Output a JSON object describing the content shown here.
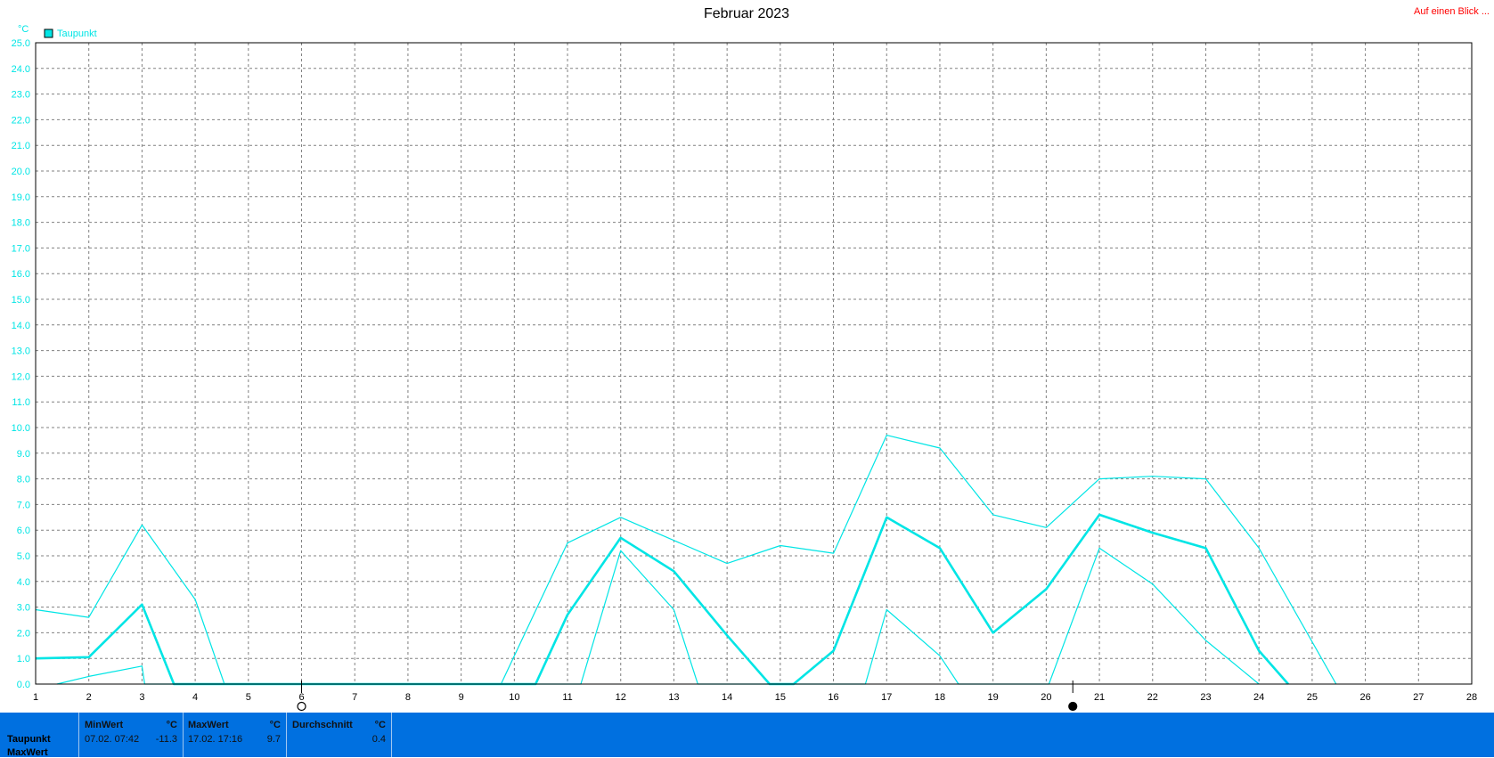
{
  "header": {
    "title": "Februar 2023",
    "quick_link": "Auf einen Blick ..."
  },
  "colors": {
    "series": "#00e5e5",
    "grid": "#808080",
    "stats_bg": "#0070e0",
    "link": "#ff0000"
  },
  "chart_data": {
    "type": "line",
    "unit": "°C",
    "legend": {
      "label": "Taupunkt",
      "placement": "top-left"
    },
    "ylim": [
      0,
      25
    ],
    "yticks": [
      "0.0",
      "1.0",
      "2.0",
      "3.0",
      "4.0",
      "5.0",
      "6.0",
      "7.0",
      "8.0",
      "9.0",
      "10.0",
      "11.0",
      "12.0",
      "13.0",
      "14.0",
      "15.0",
      "16.0",
      "17.0",
      "18.0",
      "19.0",
      "20.0",
      "21.0",
      "22.0",
      "23.0",
      "24.0",
      "25.0"
    ],
    "xlim": [
      1,
      28
    ],
    "xticks": [
      "1",
      "2",
      "3",
      "4",
      "5",
      "6",
      "7",
      "8",
      "9",
      "10",
      "11",
      "12",
      "13",
      "14",
      "15",
      "16",
      "17",
      "18",
      "19",
      "20",
      "21",
      "22",
      "23",
      "24",
      "25",
      "26",
      "27",
      "28"
    ],
    "grid": true,
    "moon_markers": [
      {
        "day": 6.0,
        "phase": "full-moon"
      },
      {
        "day": 20.5,
        "phase": "new-moon"
      }
    ],
    "series": [
      {
        "name": "Taupunkt",
        "role": "max",
        "points": [
          [
            1,
            2.9
          ],
          [
            2,
            2.6
          ],
          [
            3,
            6.2
          ],
          [
            4,
            3.3
          ],
          [
            4.55,
            0
          ],
          [
            9.75,
            0
          ],
          [
            11,
            5.5
          ],
          [
            12,
            6.5
          ],
          [
            13,
            5.6
          ],
          [
            14,
            4.7
          ],
          [
            15,
            5.4
          ],
          [
            16,
            5.1
          ],
          [
            17,
            9.7
          ],
          [
            18,
            9.2
          ],
          [
            19,
            6.6
          ],
          [
            20,
            6.1
          ],
          [
            21,
            8.0
          ],
          [
            22,
            8.1
          ],
          [
            23,
            8.0
          ],
          [
            24,
            5.3
          ],
          [
            25.45,
            0
          ]
        ]
      },
      {
        "name": "Taupunkt",
        "role": "mean",
        "points": [
          [
            1,
            1.0
          ],
          [
            2,
            1.05
          ],
          [
            3,
            3.1
          ],
          [
            3.6,
            0
          ],
          [
            10.4,
            0
          ],
          [
            11,
            2.7
          ],
          [
            12,
            5.7
          ],
          [
            13,
            4.4
          ],
          [
            14,
            1.9
          ],
          [
            14.8,
            0
          ],
          [
            15.25,
            0
          ],
          [
            16,
            1.3
          ],
          [
            17,
            6.5
          ],
          [
            18,
            5.3
          ],
          [
            19,
            2.0
          ],
          [
            20,
            3.7
          ],
          [
            21,
            6.6
          ],
          [
            22,
            5.9
          ],
          [
            23,
            5.3
          ],
          [
            24,
            1.3
          ],
          [
            24.55,
            0
          ]
        ]
      },
      {
        "name": "Taupunkt",
        "role": "min",
        "points": [
          [
            1.4,
            0
          ],
          [
            2,
            0.3
          ],
          [
            3,
            0.7
          ],
          [
            3.05,
            0
          ],
          [
            11.25,
            0
          ],
          [
            12,
            5.2
          ],
          [
            13,
            2.9
          ],
          [
            13.45,
            0
          ],
          [
            16.6,
            0
          ],
          [
            17,
            2.9
          ],
          [
            18,
            1.1
          ],
          [
            18.35,
            0
          ],
          [
            20.05,
            0
          ],
          [
            21,
            5.3
          ],
          [
            22,
            3.9
          ],
          [
            23,
            1.7
          ],
          [
            24,
            0
          ]
        ]
      }
    ]
  },
  "stats": {
    "row_labels": [
      "Taupunkt",
      "MaxWert"
    ],
    "columns": [
      {
        "header": "MinWert",
        "unit": "°C",
        "date": "07.02.  07:42",
        "value": "-11.3"
      },
      {
        "header": "MaxWert",
        "unit": "°C",
        "date": "17.02.  17:16",
        "value": "9.7"
      },
      {
        "header": "Durchschnitt",
        "unit": "°C",
        "date": "",
        "value": "0.4"
      }
    ]
  }
}
